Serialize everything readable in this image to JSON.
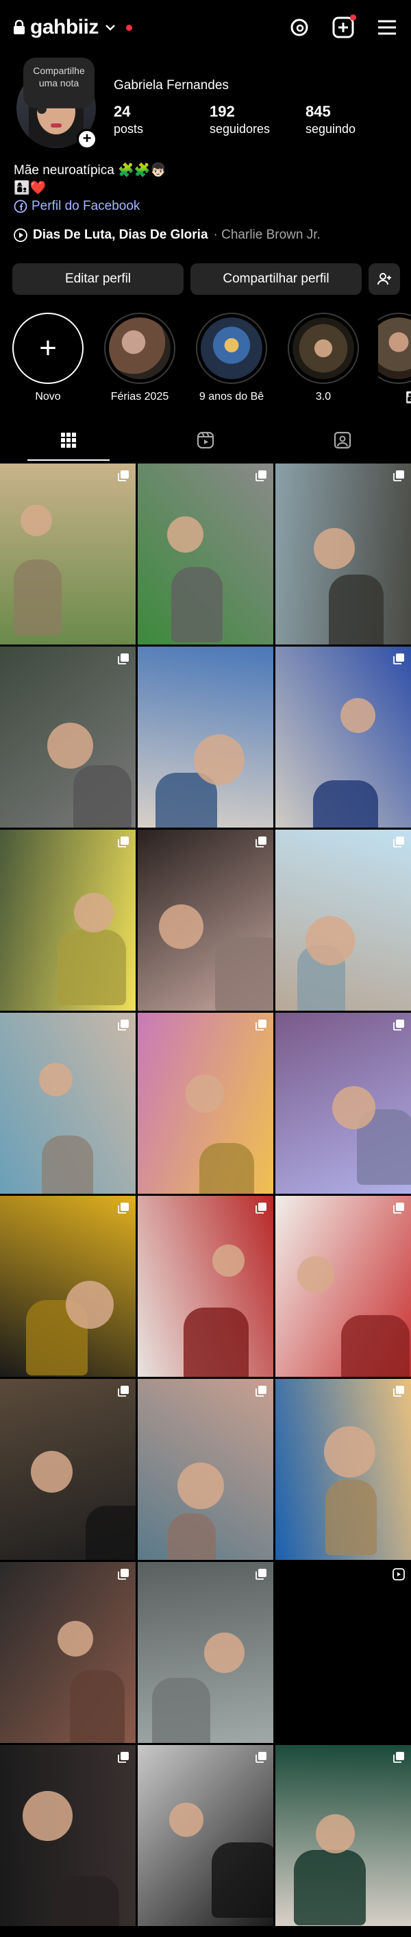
{
  "header": {
    "username": "gahbiiz",
    "icons": [
      "lock-icon",
      "chevron-down-icon",
      "threads-icon",
      "create-icon",
      "menu-icon"
    ],
    "notification_color": "#ff3040"
  },
  "profile": {
    "note": "Compartilhe uma nota",
    "display_name": "Gabriela Fernandes",
    "stats": [
      {
        "value": "24",
        "label": "posts"
      },
      {
        "value": "192",
        "label": "seguidores"
      },
      {
        "value": "845",
        "label": "seguindo"
      }
    ],
    "bio_line1": "Mãe neuroatípica 🧩🧩👦🏻",
    "bio_line2": "👩‍👦❤️",
    "facebook_link": "Perfil do Facebook",
    "music_title": "Dias De Luta, Dias De Gloria",
    "music_artist": "· Charlie Brown Jr.",
    "link_color": "#a5b8ff"
  },
  "buttons": {
    "edit": "Editar perfil",
    "share": "Compartilhar perfil"
  },
  "highlights": [
    {
      "label": "Novo",
      "kind": "new"
    },
    {
      "label": "Férias 2025",
      "kind": "photo",
      "color": "#6b4c3a"
    },
    {
      "label": "9 anos do Bê",
      "kind": "photo",
      "color": "#2f4f7f"
    },
    {
      "label": "3.0",
      "kind": "photo",
      "color": "#4a3c2a"
    },
    {
      "label": "👨‍👩‍👦",
      "kind": "photo",
      "color": "#5a4a3a"
    }
  ],
  "tabs": [
    "grid-icon",
    "reels-icon",
    "tagged-icon"
  ],
  "posts": [
    {
      "colors": [
        "#6a8a4a",
        "#c9b38a"
      ],
      "badge": "multi"
    },
    {
      "colors": [
        "#3c8a3c",
        "#8a8a8a"
      ],
      "badge": "multi"
    },
    {
      "colors": [
        "#8aa0a8",
        "#4a4a44"
      ],
      "badge": "multi"
    },
    {
      "colors": [
        "#3e4a3e",
        "#7a7a7a"
      ],
      "badge": "multi"
    },
    {
      "colors": [
        "#d8d0c8",
        "#4a78b8"
      ],
      "badge": "none"
    },
    {
      "colors": [
        "#d0ccc4",
        "#2e4ea8"
      ],
      "badge": "multi"
    },
    {
      "colors": [
        "#4a5a3a",
        "#f0e05a"
      ],
      "badge": "multi"
    },
    {
      "colors": [
        "#2a2220",
        "#c8a8a0"
      ],
      "badge": "multi"
    },
    {
      "colors": [
        "#b8a898",
        "#c0e0f0"
      ],
      "badge": "multi"
    },
    {
      "colors": [
        "#6aa0b8",
        "#c8b8a8"
      ],
      "badge": "multi"
    },
    {
      "colors": [
        "#c87ab8",
        "#f0c050"
      ],
      "badge": "multi"
    },
    {
      "colors": [
        "#7a5a8a",
        "#b0b0e8"
      ],
      "badge": "multi"
    },
    {
      "colors": [
        "#1a1a1a",
        "#e0b020"
      ],
      "badge": "multi"
    },
    {
      "colors": [
        "#e8e4e0",
        "#b82828"
      ],
      "badge": "multi"
    },
    {
      "colors": [
        "#f0eeea",
        "#c83030"
      ],
      "badge": "multi"
    },
    {
      "colors": [
        "#5a4a3a",
        "#1e1e1e"
      ],
      "badge": "multi"
    },
    {
      "colors": [
        "#5a7a8a",
        "#c8a090"
      ],
      "badge": "multi"
    },
    {
      "colors": [
        "#1a60b0",
        "#e8c080"
      ],
      "badge": "multi"
    },
    {
      "colors": [
        "#2a2a2a",
        "#8a5a4a"
      ],
      "badge": "multi"
    },
    {
      "colors": [
        "#5a6060",
        "#a0a8a8"
      ],
      "badge": "multi"
    },
    {
      "colors": [
        "#000000",
        "#000000"
      ],
      "badge": "reel"
    },
    {
      "colors": [
        "#1a1a1a",
        "#3a3030"
      ],
      "badge": "multi"
    },
    {
      "colors": [
        "#c8c8c8",
        "#1a1a1a"
      ],
      "badge": "multi"
    },
    {
      "colors": [
        "#d8d0c8",
        "#1a4a3a"
      ],
      "badge": "multi"
    }
  ]
}
